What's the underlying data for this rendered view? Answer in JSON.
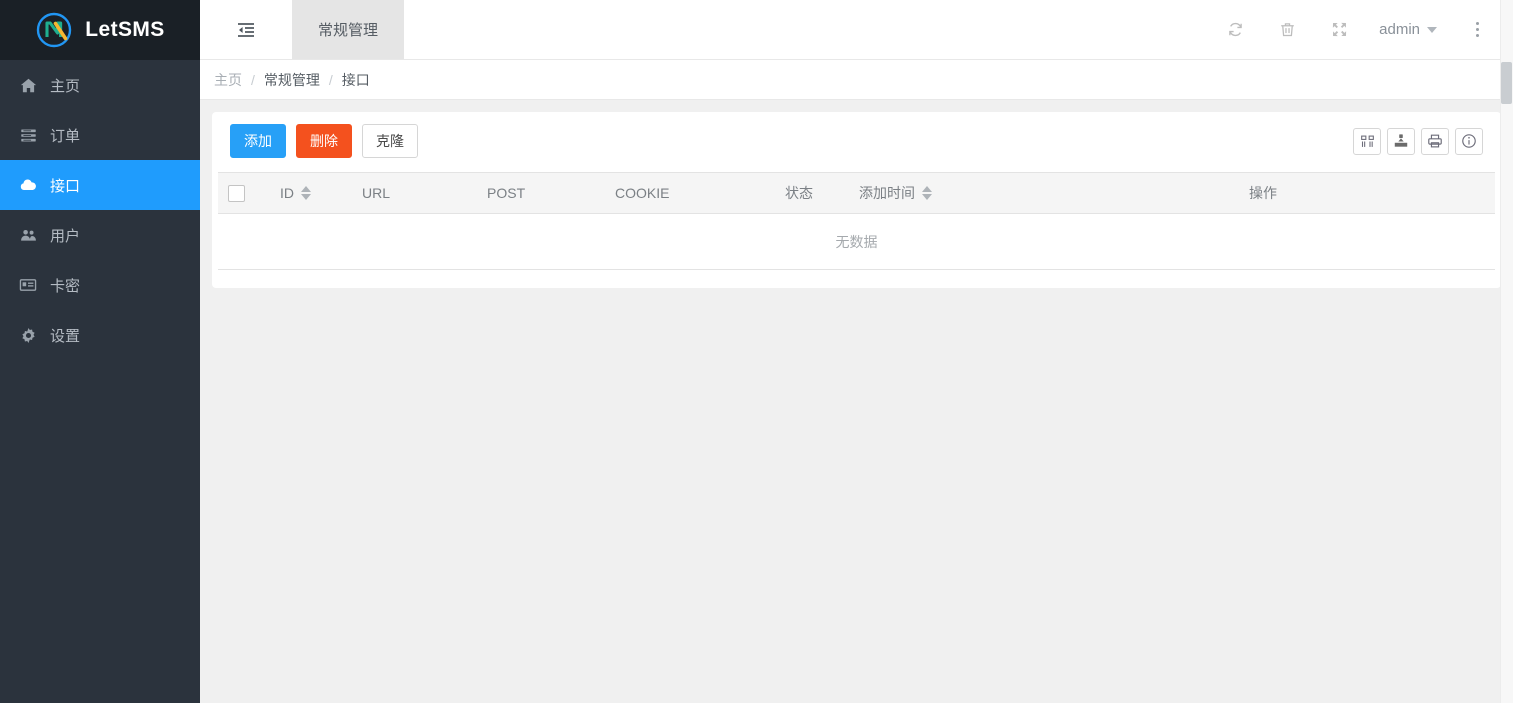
{
  "brand": {
    "name": "LetSMS",
    "logo_icon": "letsms-logo-icon"
  },
  "sidebar": {
    "items": [
      {
        "label": "主页",
        "icon": "home-icon",
        "active": false
      },
      {
        "label": "订单",
        "icon": "list-order-icon",
        "active": false
      },
      {
        "label": "接口",
        "icon": "cloud-icon",
        "active": true
      },
      {
        "label": "用户",
        "icon": "users-icon",
        "active": false
      },
      {
        "label": "卡密",
        "icon": "id-card-icon",
        "active": false
      },
      {
        "label": "设置",
        "icon": "gear-icon",
        "active": false
      }
    ]
  },
  "topbar": {
    "collapse_icon": "sidebar-collapse-icon",
    "tabs": [
      {
        "label": "常规管理",
        "active": true
      }
    ],
    "actions": [
      {
        "name": "refresh-icon",
        "title": "刷新"
      },
      {
        "name": "trash-icon",
        "title": "删除"
      },
      {
        "name": "fullscreen-icon",
        "title": "全屏"
      }
    ],
    "user": "admin",
    "more_icon": "vertical-dots-icon"
  },
  "breadcrumb": {
    "items": [
      "主页",
      "常规管理",
      "接口"
    ],
    "separator": "/"
  },
  "toolbar": {
    "add_label": "添加",
    "delete_label": "删除",
    "clone_label": "克隆",
    "icons": [
      {
        "name": "columns-icon",
        "title": "列"
      },
      {
        "name": "export-icon",
        "title": "导出"
      },
      {
        "name": "print-icon",
        "title": "打印"
      },
      {
        "name": "info-icon",
        "title": "详情"
      }
    ]
  },
  "table": {
    "columns": [
      {
        "key": "check",
        "label": "",
        "sortable": false
      },
      {
        "key": "id",
        "label": "ID",
        "sortable": true
      },
      {
        "key": "url",
        "label": "URL",
        "sortable": false
      },
      {
        "key": "post",
        "label": "POST",
        "sortable": false
      },
      {
        "key": "cookie",
        "label": "COOKIE",
        "sortable": false
      },
      {
        "key": "state",
        "label": "状态",
        "sortable": false
      },
      {
        "key": "time",
        "label": "添加时间",
        "sortable": true
      },
      {
        "key": "op",
        "label": "操作",
        "sortable": false
      }
    ],
    "rows": [],
    "empty_text": "无数据"
  },
  "colors": {
    "accent": "#1f9cfd",
    "sidebar_bg": "#2b333d",
    "sidebar_logo_bg": "#1a2026",
    "primary_btn": "#27a0f7",
    "danger_btn": "#f4511e",
    "page_bg": "#f0f0f0",
    "tab_active_bg": "#e5e5e5"
  }
}
